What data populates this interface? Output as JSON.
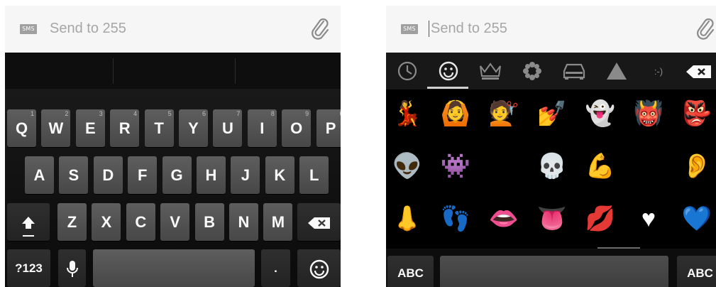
{
  "left": {
    "compose": {
      "badge": "SMS",
      "placeholder": "Send to 255"
    },
    "rows": [
      [
        {
          "label": "Q",
          "hint": "1"
        },
        {
          "label": "W",
          "hint": "2"
        },
        {
          "label": "E",
          "hint": "3"
        },
        {
          "label": "R",
          "hint": "4"
        },
        {
          "label": "T",
          "hint": "5"
        },
        {
          "label": "Y",
          "hint": "6"
        },
        {
          "label": "U",
          "hint": "7"
        },
        {
          "label": "I",
          "hint": "8"
        },
        {
          "label": "O",
          "hint": "9"
        },
        {
          "label": "P",
          "hint": "0"
        }
      ],
      [
        {
          "label": "A"
        },
        {
          "label": "S"
        },
        {
          "label": "D"
        },
        {
          "label": "F"
        },
        {
          "label": "G"
        },
        {
          "label": "H"
        },
        {
          "label": "J"
        },
        {
          "label": "K"
        },
        {
          "label": "L"
        }
      ],
      [
        {
          "label": "Z"
        },
        {
          "label": "X"
        },
        {
          "label": "C"
        },
        {
          "label": "V"
        },
        {
          "label": "B"
        },
        {
          "label": "N"
        },
        {
          "label": "M"
        }
      ]
    ],
    "bottom": {
      "symbols": "?123",
      "period": "."
    },
    "icons": {
      "shift": "shift-arrow-icon",
      "delete": "backspace-icon",
      "mic": "microphone-icon",
      "emoji": "smiley-icon"
    }
  },
  "right": {
    "compose": {
      "badge": "SMS",
      "placeholder": "Send to 255"
    },
    "categories": [
      {
        "name": "recent",
        "icon": "clock-icon"
      },
      {
        "name": "faces",
        "icon": "smiley-icon",
        "active": true
      },
      {
        "name": "objects",
        "icon": "crown-icon"
      },
      {
        "name": "nature",
        "icon": "flower-icon"
      },
      {
        "name": "places",
        "icon": "car-icon"
      },
      {
        "name": "symbols",
        "icon": "triangle-icon"
      },
      {
        "name": "emoticons",
        "label": ":-)"
      }
    ],
    "emoji_rows": [
      [
        "💃",
        "🙆",
        "💇",
        "💅",
        "👻",
        "👹",
        "👺"
      ],
      [
        "👽",
        "👾",
        "😈",
        "💀",
        "💪",
        "👁",
        "👂"
      ],
      [
        "👃",
        "👣",
        "👄",
        "👅",
        "💋",
        "♥",
        "💙"
      ]
    ],
    "bottom": {
      "abc_left": "ABC",
      "abc_right": "ABC"
    }
  }
}
